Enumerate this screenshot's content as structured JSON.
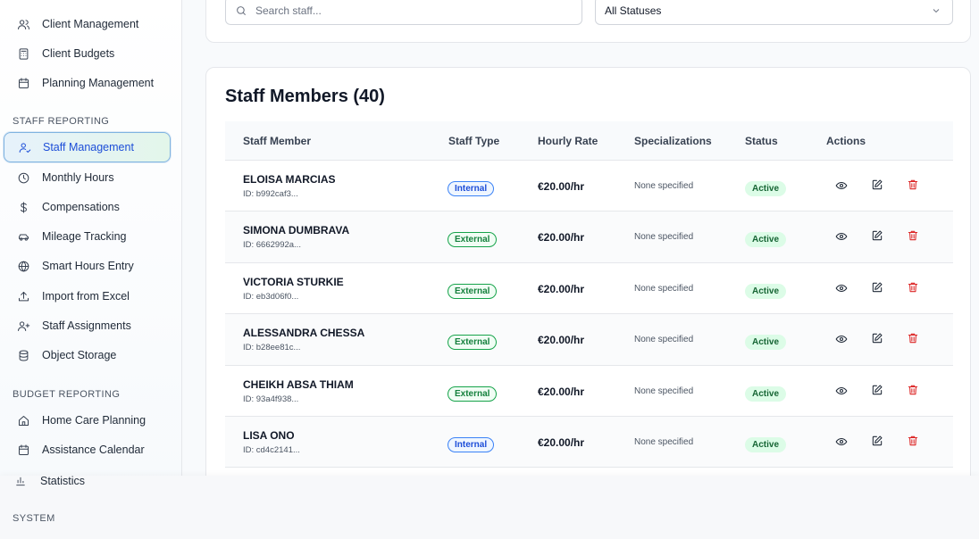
{
  "sidebar": {
    "sections": {
      "staff_reporting": "STAFF REPORTING",
      "budget_reporting": "BUDGET REPORTING",
      "system": "SYSTEM"
    },
    "items": [
      {
        "label": "Client Management",
        "icon": "users-icon"
      },
      {
        "label": "Client Budgets",
        "icon": "calculator-icon"
      },
      {
        "label": "Planning Management",
        "icon": "calendar-icon"
      },
      {
        "label": "Staff Management",
        "icon": "user-icon",
        "active": true
      },
      {
        "label": "Monthly Hours",
        "icon": "clock-icon"
      },
      {
        "label": "Compensations",
        "icon": "dollar-icon"
      },
      {
        "label": "Mileage Tracking",
        "icon": "car-icon"
      },
      {
        "label": "Smart Hours Entry",
        "icon": "globe-icon"
      },
      {
        "label": "Import from Excel",
        "icon": "upload-icon"
      },
      {
        "label": "Staff Assignments",
        "icon": "user-plus-icon"
      },
      {
        "label": "Object Storage",
        "icon": "database-icon"
      },
      {
        "label": "Home Care Planning",
        "icon": "home-icon"
      },
      {
        "label": "Assistance Calendar",
        "icon": "calendar-icon"
      },
      {
        "label": "Statistics",
        "icon": "bar-chart-icon"
      }
    ]
  },
  "filters": {
    "search_placeholder": "Search staff...",
    "status_value": "All Statuses"
  },
  "staff": {
    "title": "Staff Members (40)",
    "columns": [
      "Staff Member",
      "Staff Type",
      "Hourly Rate",
      "Specializations",
      "Status",
      "Actions"
    ],
    "rows": [
      {
        "name": "ELOISA MARCIAS",
        "id": "ID: b992caf3...",
        "type": "Internal",
        "rate": "€20.00/hr",
        "spec": "None specified",
        "status": "Active"
      },
      {
        "name": "SIMONA DUMBRAVA",
        "id": "ID: 6662992a...",
        "type": "External",
        "rate": "€20.00/hr",
        "spec": "None specified",
        "status": "Active"
      },
      {
        "name": "VICTORIA STURKIE",
        "id": "ID: eb3d06f0...",
        "type": "External",
        "rate": "€20.00/hr",
        "spec": "None specified",
        "status": "Active"
      },
      {
        "name": "ALESSANDRA CHESSA",
        "id": "ID: b28ee81c...",
        "type": "External",
        "rate": "€20.00/hr",
        "spec": "None specified",
        "status": "Active"
      },
      {
        "name": "CHEIKH ABSA THIAM",
        "id": "ID: 93a4f938...",
        "type": "External",
        "rate": "€20.00/hr",
        "spec": "None specified",
        "status": "Active"
      },
      {
        "name": "LISA ONO",
        "id": "ID: cd4c2141...",
        "type": "Internal",
        "rate": "€20.00/hr",
        "spec": "None specified",
        "status": "Active"
      }
    ]
  },
  "colors": {
    "accent": "#1d4ed8",
    "active_status_bg": "#dcfce7",
    "delete": "#dc2626"
  }
}
